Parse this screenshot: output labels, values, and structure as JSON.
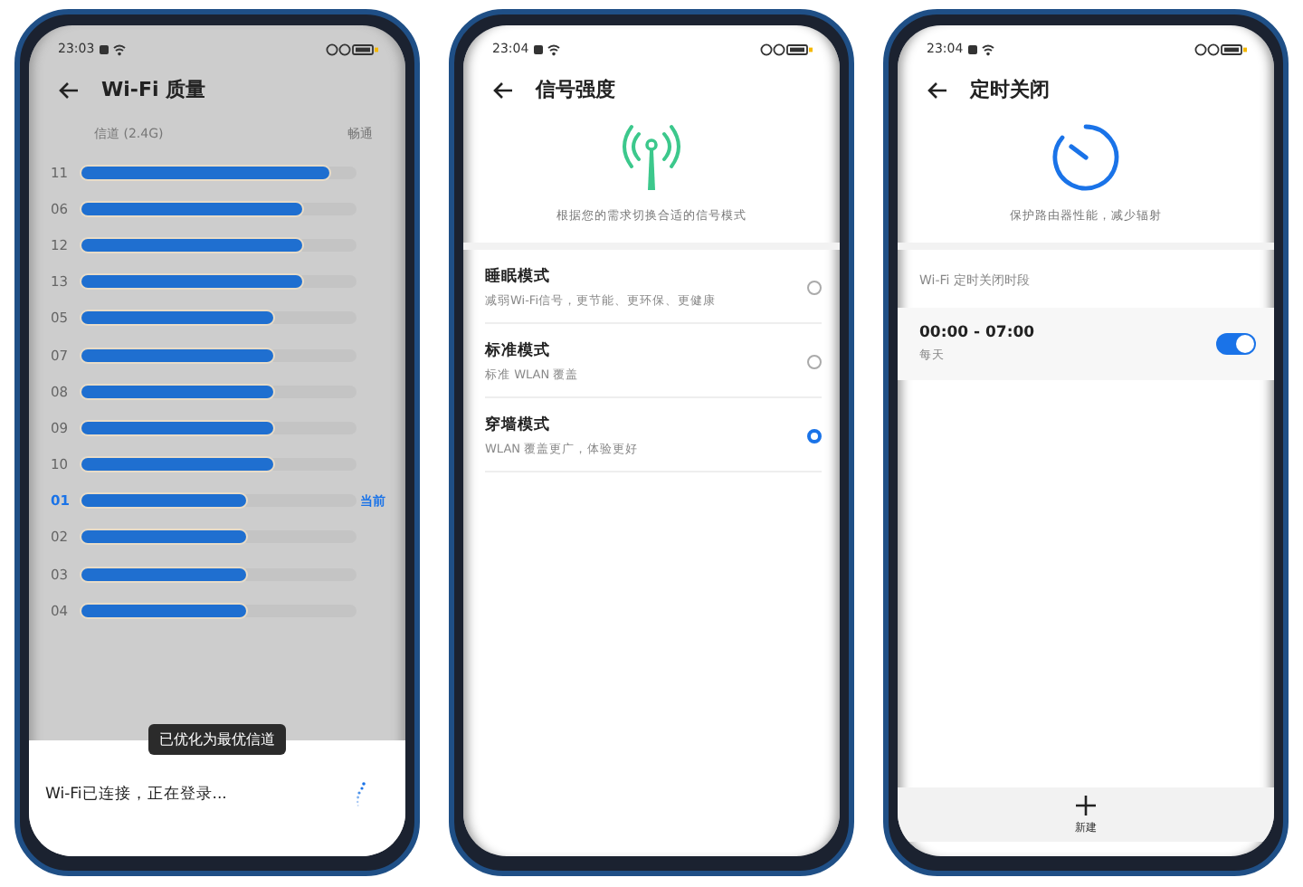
{
  "phones": [
    {
      "kind": "channels",
      "status_time": "23:03",
      "title": "Wi-Fi 质量",
      "header_left": "信道 (2.4G)",
      "header_right": "畅通",
      "current_label": "当前",
      "toast": "已优化为最优信道",
      "sheet_text": "Wi-Fi已连接，正在登录...",
      "channels": [
        {
          "name": "11",
          "level": 0.9,
          "selected": false
        },
        {
          "name": "06",
          "level": 0.8,
          "selected": false
        },
        {
          "name": "12",
          "level": 0.8,
          "selected": false
        },
        {
          "name": "13",
          "level": 0.8,
          "selected": false
        },
        {
          "name": "05",
          "level": 0.7,
          "selected": false
        },
        {
          "name": "07",
          "level": 0.7,
          "selected": false
        },
        {
          "name": "08",
          "level": 0.7,
          "selected": false
        },
        {
          "name": "09",
          "level": 0.7,
          "selected": false
        },
        {
          "name": "10",
          "level": 0.7,
          "selected": false
        },
        {
          "name": "01",
          "level": 0.6,
          "selected": true
        },
        {
          "name": "02",
          "level": 0.6,
          "selected": false
        },
        {
          "name": "03",
          "level": 0.6,
          "selected": false
        },
        {
          "name": "04",
          "level": 0.6,
          "selected": false
        }
      ]
    },
    {
      "kind": "modes",
      "status_time": "23:04",
      "title": "信号强度",
      "description": "根据您的需求切换合适的信号模式",
      "modes": [
        {
          "title": "睡眠模式",
          "subtitle": "减弱Wi-Fi信号，更节能、更环保、更健康",
          "selected": false
        },
        {
          "title": "标准模式",
          "subtitle": "标准 WLAN 覆盖",
          "selected": false
        },
        {
          "title": "穿墙模式",
          "subtitle": "WLAN 覆盖更广，体验更好",
          "selected": true
        }
      ]
    },
    {
      "kind": "timer",
      "status_time": "23:04",
      "title": "定时关闭",
      "description": "保护路由器性能，减少辐射",
      "section": "Wi-Fi 定时关闭时段",
      "add_label": "新建",
      "schedules": [
        {
          "time": "00:00 - 07:00",
          "repeat": "每天",
          "on": true
        }
      ]
    }
  ]
}
